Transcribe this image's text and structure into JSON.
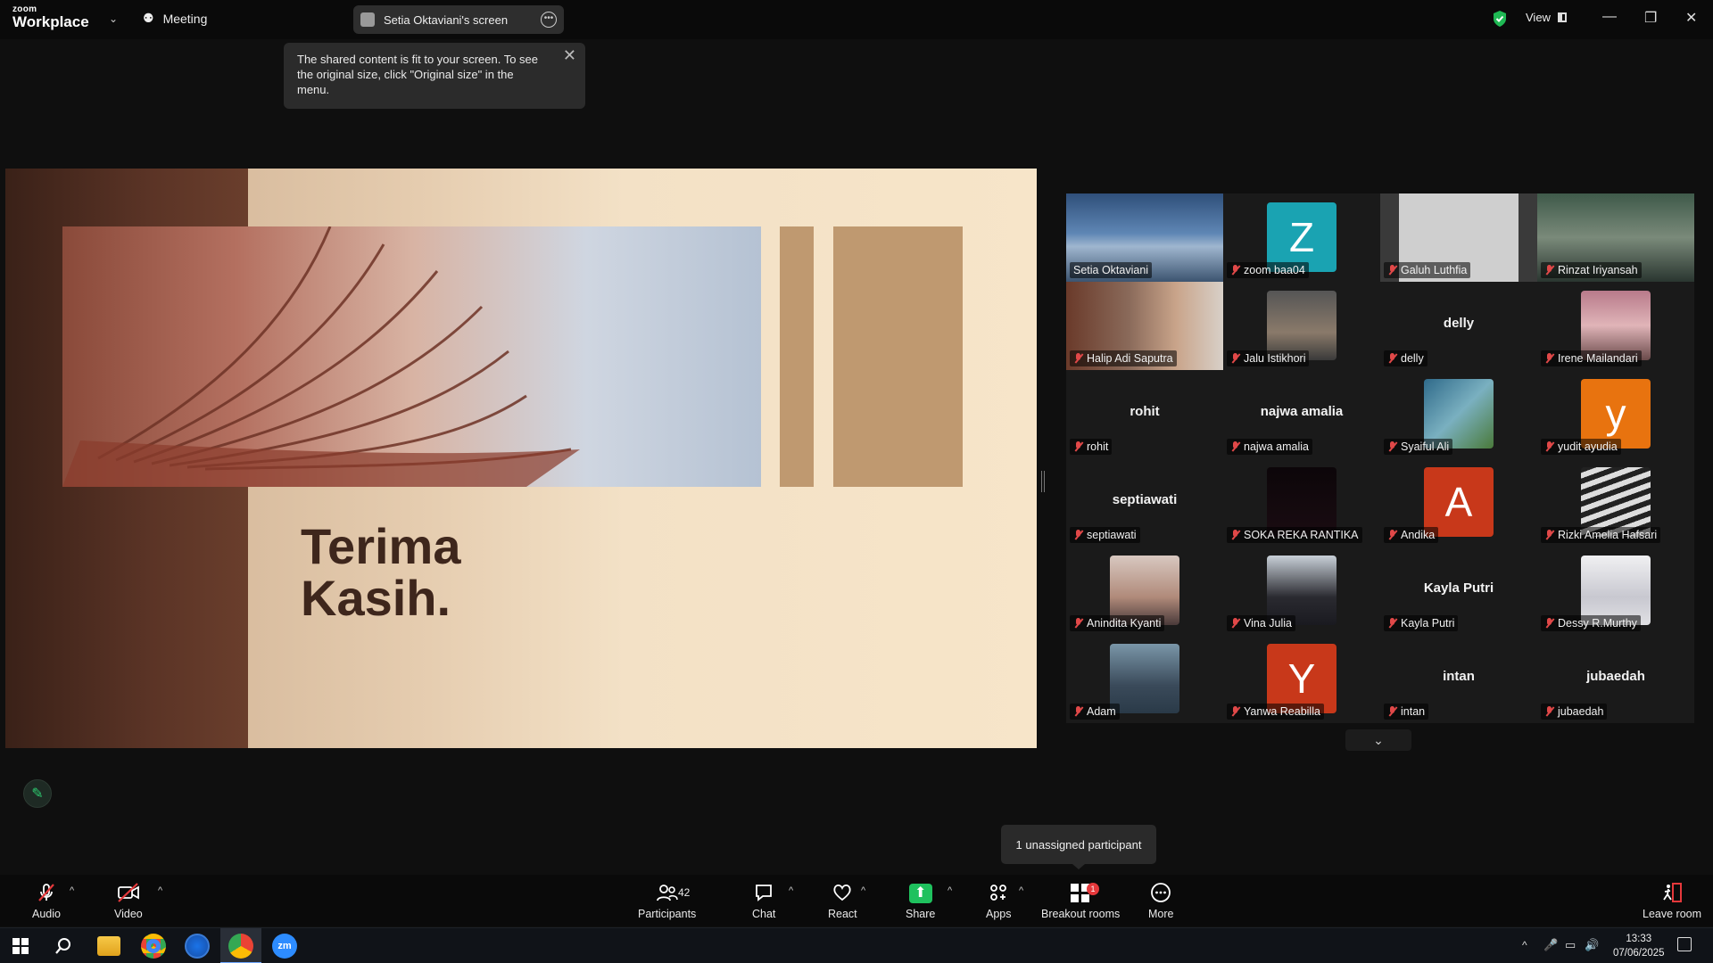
{
  "app": {
    "logo_top": "zoom",
    "logo_bottom": "Workplace",
    "meeting_label": "Meeting",
    "shared_screen_label": "Setia Oktaviani's screen",
    "view_label": "View"
  },
  "tooltip": {
    "text": "The shared content is fit to your screen. To see the original size, click \"Original size\" in the menu."
  },
  "slide": {
    "title": "Terima\nKasih."
  },
  "gallery": {
    "tiles": [
      {
        "name": "Setia Oktaviani",
        "muted": false,
        "kind": "video-desk"
      },
      {
        "name": "zoom baa04",
        "muted": true,
        "kind": "avatar",
        "letter": "Z",
        "color": "#1aa3b2"
      },
      {
        "name": "Galuh Luthfia",
        "muted": true,
        "kind": "video-person",
        "active": true
      },
      {
        "name": "Rinzat Iriyansah",
        "muted": true,
        "kind": "video-person2"
      },
      {
        "name": "Halip Adi Saputra",
        "muted": true,
        "kind": "video-person3"
      },
      {
        "name": "Jalu Istikhori",
        "muted": true,
        "kind": "photo"
      },
      {
        "name": "delly",
        "muted": true,
        "kind": "name",
        "display": "delly"
      },
      {
        "name": "Irene Mailandari",
        "muted": true,
        "kind": "photo2"
      },
      {
        "name": "rohit",
        "muted": true,
        "kind": "name",
        "display": "rohit"
      },
      {
        "name": "najwa amalia",
        "muted": true,
        "kind": "name",
        "display": "najwa amalia"
      },
      {
        "name": "Syaiful Ali",
        "muted": true,
        "kind": "photo3"
      },
      {
        "name": "yudit ayudia",
        "muted": true,
        "kind": "avatar",
        "letter": "y",
        "color": "#e8730f"
      },
      {
        "name": "septiawati",
        "muted": true,
        "kind": "name",
        "display": "septiawati"
      },
      {
        "name": "SOKA REKA RANTIKA",
        "muted": true,
        "kind": "photo-dark"
      },
      {
        "name": "Andika",
        "muted": true,
        "kind": "avatar",
        "letter": "A",
        "color": "#c8381a"
      },
      {
        "name": "Rizki Amelia Hafsari",
        "muted": true,
        "kind": "photo4"
      },
      {
        "name": "Anindita Kyanti",
        "muted": true,
        "kind": "photo5"
      },
      {
        "name": "Vina Julia",
        "muted": true,
        "kind": "photo6"
      },
      {
        "name": "Kayla Putri",
        "muted": true,
        "kind": "name",
        "display": "Kayla Putri"
      },
      {
        "name": "Dessy R.Murthy",
        "muted": true,
        "kind": "photo7"
      },
      {
        "name": "Adam",
        "muted": true,
        "kind": "photo8"
      },
      {
        "name": "Yanwa Reabilla",
        "muted": true,
        "kind": "avatar",
        "letter": "Y",
        "color": "#c8381a"
      },
      {
        "name": "intan",
        "muted": true,
        "kind": "name",
        "display": "intan"
      },
      {
        "name": "jubaedah",
        "muted": true,
        "kind": "name",
        "display": "jubaedah"
      }
    ]
  },
  "unassigned": "1 unassigned participant",
  "toolbar": {
    "audio": "Audio",
    "video": "Video",
    "participants": "Participants",
    "participants_count": "42",
    "chat": "Chat",
    "react": "React",
    "share": "Share",
    "apps": "Apps",
    "breakout": "Breakout rooms",
    "breakout_badge": "1",
    "more": "More",
    "leave": "Leave room"
  },
  "taskbar": {
    "time": "13:33",
    "date": "07/06/2025"
  },
  "colors": {
    "accent_green": "#2ecc71",
    "mute_red": "#e04848",
    "share_green": "#1fc15e"
  }
}
